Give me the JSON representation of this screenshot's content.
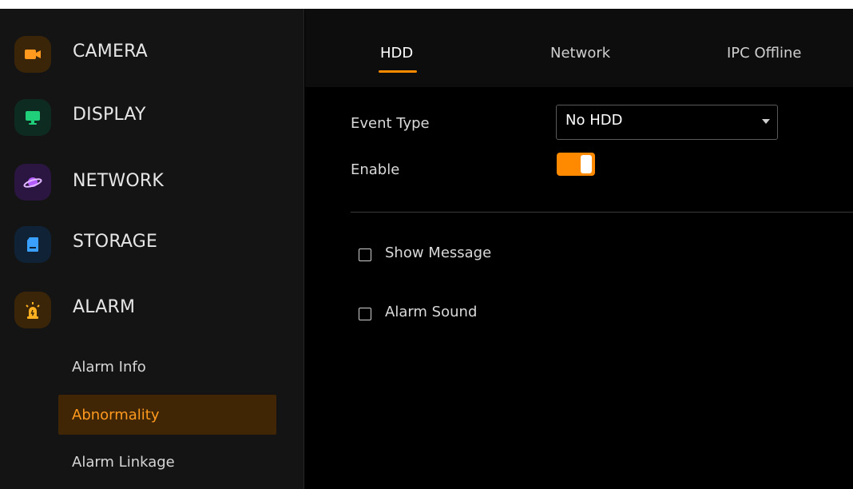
{
  "sidebar": {
    "items": [
      {
        "label": "CAMERA",
        "icon": "camera-icon",
        "icon_color": "#ff9a1f",
        "bg": "#3a2508"
      },
      {
        "label": "DISPLAY",
        "icon": "monitor-icon",
        "icon_color": "#1fcf7a",
        "bg": "#0e2b22"
      },
      {
        "label": "NETWORK",
        "icon": "planet-icon",
        "icon_color": "#b35cff",
        "bg": "#2a1640"
      },
      {
        "label": "STORAGE",
        "icon": "storage-card-icon",
        "icon_color": "#3aa0ff",
        "bg": "#0f2236"
      },
      {
        "label": "ALARM",
        "icon": "alarm-siren-icon",
        "icon_color": "#ffb020",
        "bg": "#3a2508"
      }
    ],
    "sub_items": [
      {
        "label": "Alarm Info",
        "active": false
      },
      {
        "label": "Abnormality",
        "active": true
      },
      {
        "label": "Alarm Linkage",
        "active": false
      }
    ]
  },
  "tabs": [
    {
      "label": "HDD",
      "active": true
    },
    {
      "label": "Network",
      "active": false
    },
    {
      "label": "IPC Offline",
      "active": false
    }
  ],
  "form": {
    "event_type_label": "Event Type",
    "event_type_value": "No HDD",
    "enable_label": "Enable",
    "enable_on": true,
    "show_message_label": "Show Message",
    "show_message_checked": false,
    "alarm_sound_label": "Alarm Sound",
    "alarm_sound_checked": false
  },
  "colors": {
    "accent": "#ff8a00",
    "active_sub_bg": "#402605",
    "active_sub_text": "#ff9a1f"
  }
}
